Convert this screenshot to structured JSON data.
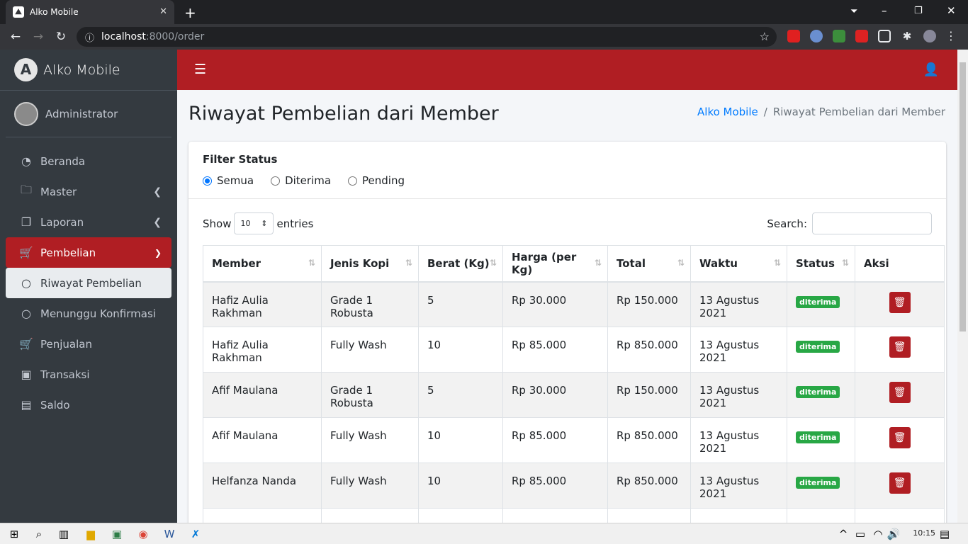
{
  "browser": {
    "tab_title": "Alko Mobile",
    "url_host": "localhost",
    "url_path": ":8000/order"
  },
  "sidebar": {
    "brand": "Alko Mobile",
    "user": "Administrator",
    "items": [
      {
        "label": "Beranda",
        "icon": "tachometer-icon"
      },
      {
        "label": "Master",
        "icon": "folder-icon"
      },
      {
        "label": "Laporan",
        "icon": "copy-icon"
      },
      {
        "label": "Pembelian",
        "icon": "cart-plus-icon"
      },
      {
        "label": "Riwayat Pembelian",
        "icon": "circle-icon"
      },
      {
        "label": "Menunggu Konfirmasi",
        "icon": "circle-icon"
      },
      {
        "label": "Penjualan",
        "icon": "cart-icon"
      },
      {
        "label": "Transaksi",
        "icon": "money-icon"
      },
      {
        "label": "Saldo",
        "icon": "wallet-icon"
      }
    ]
  },
  "page": {
    "title": "Riwayat Pembelian dari Member",
    "breadcrumb_home": "Alko Mobile",
    "breadcrumb_current": "Riwayat Pembelian dari Member"
  },
  "filter": {
    "heading": "Filter Status",
    "options": [
      "Semua",
      "Diterima",
      "Pending"
    ],
    "selected": "Semua"
  },
  "table_controls": {
    "show_label": "Show",
    "entries_value": "10",
    "entries_label": "entries",
    "search_label": "Search:"
  },
  "table": {
    "columns": [
      "Member",
      "Jenis Kopi",
      "Berat (Kg)",
      "Harga (per Kg)",
      "Total",
      "Waktu",
      "Status",
      "Aksi"
    ],
    "rows": [
      [
        "Hafiz Aulia Rakhman",
        "Grade 1 Robusta",
        "5",
        "Rp 30.000",
        "Rp 150.000",
        "13 Agustus 2021",
        "diterima"
      ],
      [
        "Hafiz Aulia Rakhman",
        "Fully Wash",
        "10",
        "Rp 85.000",
        "Rp 850.000",
        "13 Agustus 2021",
        "diterima"
      ],
      [
        "Afif Maulana",
        "Grade 1 Robusta",
        "5",
        "Rp 30.000",
        "Rp 150.000",
        "13 Agustus 2021",
        "diterima"
      ],
      [
        "Afif Maulana",
        "Fully Wash",
        "10",
        "Rp 85.000",
        "Rp 850.000",
        "13 Agustus 2021",
        "diterima"
      ],
      [
        "Helfanza Nanda",
        "Fully Wash",
        "10",
        "Rp 85.000",
        "Rp 850.000",
        "13 Agustus 2021",
        "diterima"
      ]
    ]
  },
  "taskbar": {
    "time": "10:15"
  },
  "colors": {
    "brand_red": "#b01e23",
    "sidebar_bg": "#343a40",
    "badge_green": "#28a745"
  }
}
